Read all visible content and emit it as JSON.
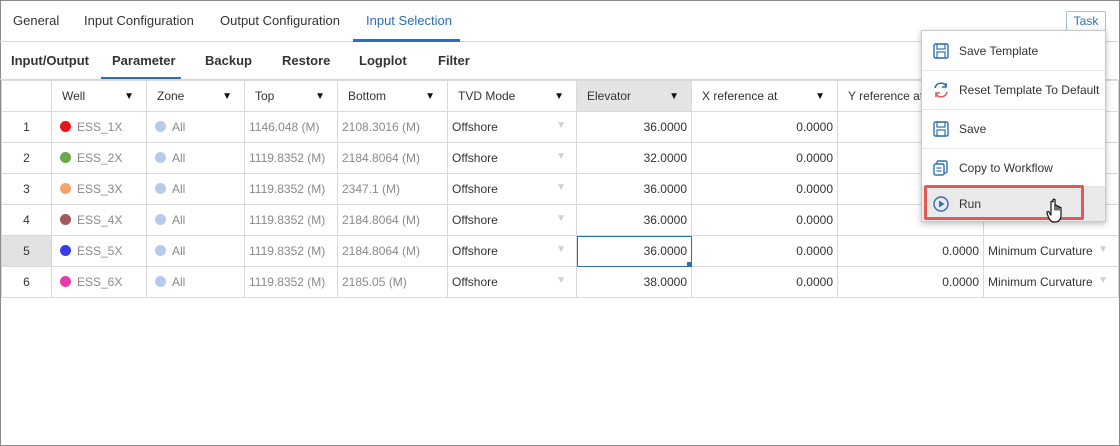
{
  "top_tabs": [
    {
      "label": "General"
    },
    {
      "label": "Input Configuration"
    },
    {
      "label": "Output Configuration"
    },
    {
      "label": "Input Selection",
      "active": true
    }
  ],
  "task_button": "Task",
  "sub_tabs": [
    {
      "label": "Input/Output"
    },
    {
      "label": "Parameter",
      "active": true
    },
    {
      "label": "Backup"
    },
    {
      "label": "Restore"
    },
    {
      "label": "Logplot"
    },
    {
      "label": "Filter"
    }
  ],
  "table": {
    "columns": [
      "Well",
      "Zone",
      "Top",
      "Bottom",
      "TVD Mode",
      "Elevator",
      "X reference at",
      "Y reference at",
      ""
    ],
    "rows": [
      {
        "n": "1",
        "well": "ESS_1X",
        "well_color": "#e8141a",
        "zone": "All",
        "top": "1146.048 (M)",
        "bottom": "2108.3016 (M)",
        "tvd": "Offshore",
        "elevator": "36.0000",
        "xref": "0.0000",
        "yref": "",
        "method": ""
      },
      {
        "n": "2",
        "well": "ESS_2X",
        "well_color": "#6aa84f",
        "zone": "All",
        "top": "1119.8352 (M)",
        "bottom": "2184.8064 (M)",
        "tvd": "Offshore",
        "elevator": "32.0000",
        "xref": "0.0000",
        "yref": "",
        "method": ""
      },
      {
        "n": "3",
        "well": "ESS_3X",
        "well_color": "#f4a26a",
        "zone": "All",
        "top": "1119.8352 (M)",
        "bottom": "2347.1 (M)",
        "tvd": "Offshore",
        "elevator": "36.0000",
        "xref": "0.0000",
        "yref": "",
        "method": ""
      },
      {
        "n": "4",
        "well": "ESS_4X",
        "well_color": "#a05a5a",
        "zone": "All",
        "top": "1119.8352 (M)",
        "bottom": "2184.8064 (M)",
        "tvd": "Offshore",
        "elevator": "36.0000",
        "xref": "0.0000",
        "yref": "",
        "method": ""
      },
      {
        "n": "5",
        "well": "ESS_5X",
        "well_color": "#3b3be8",
        "zone": "All",
        "top": "1119.8352 (M)",
        "bottom": "2184.8064 (M)",
        "tvd": "Offshore",
        "elevator": "36.0000",
        "xref": "0.0000",
        "yref": "0.0000",
        "method": "Minimum Curvature"
      },
      {
        "n": "6",
        "well": "ESS_6X",
        "well_color": "#e83aa8",
        "zone": "All",
        "top": "1119.8352 (M)",
        "bottom": "2185.05 (M)",
        "tvd": "Offshore",
        "elevator": "38.0000",
        "xref": "0.0000",
        "yref": "0.0000",
        "method": "Minimum Curvature"
      }
    ],
    "zone_color": "#b8c9ee"
  },
  "context_menu": {
    "items": [
      {
        "label": "Save Template",
        "icon": "save-template-icon"
      },
      {
        "label": "Reset Template To Default",
        "icon": "reset-icon"
      },
      {
        "label": "Save",
        "icon": "save-icon"
      },
      {
        "label": "Copy to Workflow",
        "icon": "copy-icon"
      },
      {
        "label": "Run",
        "icon": "play-icon"
      }
    ]
  },
  "colors": {
    "accent": "#2d6fb5",
    "highlight": "#e05a5a"
  }
}
